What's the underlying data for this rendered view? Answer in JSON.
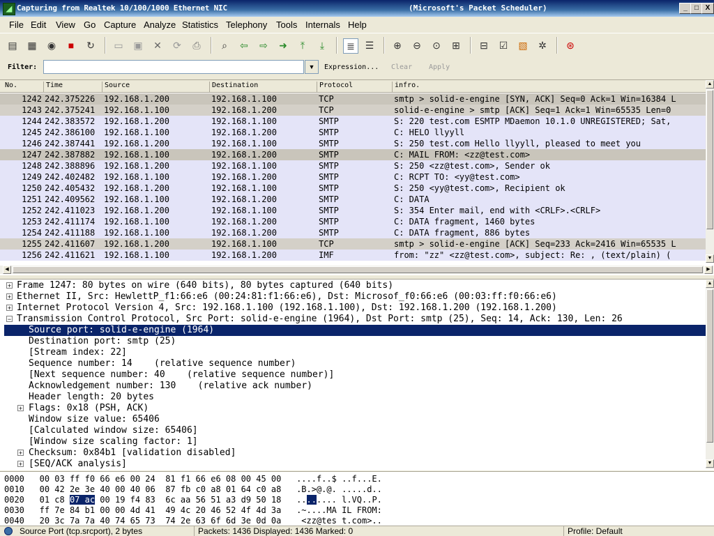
{
  "window": {
    "title": "Capturing from Realtek 10/100/1000 Ethernet NIC",
    "title_suffix": "(Microsoft's Packet Scheduler)",
    "minimize": "_",
    "maximize": "□",
    "close": "X"
  },
  "menu": [
    "File",
    "Edit",
    "View",
    "Go",
    "Capture",
    "Analyze",
    "Statistics",
    "Telephony",
    "Tools",
    "Internals",
    "Help"
  ],
  "filter": {
    "label": "Filter:",
    "value": "",
    "expression": "Expression...",
    "clear": "Clear",
    "apply": "Apply"
  },
  "packet_list": {
    "columns": [
      "No.",
      "Time",
      "Source",
      "Destination",
      "Protocol",
      "infro."
    ],
    "rows": [
      {
        "no": "1242",
        "time": "242.375226",
        "src": "192.168.1.200",
        "dst": "192.168.1.100",
        "proto": "TCP",
        "info": "smtp > solid-e-engine [SYN, ACK] Seq=0 Ack=1 Win=16384 L"
      },
      {
        "no": "1243",
        "time": "242.375241",
        "src": "192.168.1.100",
        "dst": "192.168.1.200",
        "proto": "TCP",
        "info": "solid-e-engine > smtp [ACK] Seq=1 Ack=1 Win=65535 Len=0"
      },
      {
        "no": "1244",
        "time": "242.383572",
        "src": "192.168.1.200",
        "dst": "192.168.1.100",
        "proto": "SMTP",
        "info": "S: 220 test.com ESMTP MDaemon 10.1.0 UNREGISTERED; Sat,"
      },
      {
        "no": "1245",
        "time": "242.386100",
        "src": "192.168.1.100",
        "dst": "192.168.1.200",
        "proto": "SMTP",
        "info": "C: HELO llyyll"
      },
      {
        "no": "1246",
        "time": "242.387441",
        "src": "192.168.1.200",
        "dst": "192.168.1.100",
        "proto": "SMTP",
        "info": "S: 250 test.com Hello llyyll, pleased to meet you"
      },
      {
        "no": "1247",
        "time": "242.387882",
        "src": "192.168.1.100",
        "dst": "192.168.1.200",
        "proto": "SMTP",
        "info": "C: MAIL FROM: <zz@test.com>"
      },
      {
        "no": "1248",
        "time": "242.388896",
        "src": "192.168.1.200",
        "dst": "192.168.1.100",
        "proto": "SMTP",
        "info": "S: 250 <zz@test.com>, Sender ok"
      },
      {
        "no": "1249",
        "time": "242.402482",
        "src": "192.168.1.100",
        "dst": "192.168.1.200",
        "proto": "SMTP",
        "info": "C: RCPT TO: <yy@test.com>"
      },
      {
        "no": "1250",
        "time": "242.405432",
        "src": "192.168.1.200",
        "dst": "192.168.1.100",
        "proto": "SMTP",
        "info": "S: 250 <yy@test.com>, Recipient ok"
      },
      {
        "no": "1251",
        "time": "242.409562",
        "src": "192.168.1.100",
        "dst": "192.168.1.200",
        "proto": "SMTP",
        "info": "C: DATA"
      },
      {
        "no": "1252",
        "time": "242.411023",
        "src": "192.168.1.200",
        "dst": "192.168.1.100",
        "proto": "SMTP",
        "info": "S: 354 Enter mail, end with <CRLF>.<CRLF>"
      },
      {
        "no": "1253",
        "time": "242.411174",
        "src": "192.168.1.100",
        "dst": "192.168.1.200",
        "proto": "SMTP",
        "info": "C: DATA fragment, 1460 bytes"
      },
      {
        "no": "1254",
        "time": "242.411188",
        "src": "192.168.1.100",
        "dst": "192.168.1.200",
        "proto": "SMTP",
        "info": "C: DATA fragment, 886 bytes"
      },
      {
        "no": "1255",
        "time": "242.411607",
        "src": "192.168.1.200",
        "dst": "192.168.1.100",
        "proto": "TCP",
        "info": "smtp > solid-e-engine [ACK] Seq=233 Ack=2416 Win=65535 L"
      },
      {
        "no": "1256",
        "time": "242.411621",
        "src": "192.168.1.100",
        "dst": "192.168.1.200",
        "proto": "IMF",
        "info": "from: \"zz\" <zz@test.com>, subject: Re: ,  (text/plain) ("
      }
    ],
    "tcp_color": "#d4d0c8",
    "smtp_color": "#e4e4f8",
    "selected_color": "#c9c5bb"
  },
  "details": [
    {
      "expander": "+",
      "text": "Frame 1247: 80 bytes on wire (640 bits), 80 bytes captured (640 bits)"
    },
    {
      "expander": "+",
      "text": "Ethernet II, Src: HewlettP_f1:66:e6 (00:24:81:f1:66:e6), Dst: Microsof_f0:66:e6 (00:03:ff:f0:66:e6)"
    },
    {
      "expander": "+",
      "text": "Internet Protocol Version 4, Src: 192.168.1.100 (192.168.1.100), Dst: 192.168.1.200 (192.168.1.200)"
    },
    {
      "expander": "−",
      "text": "Transmission Control Protocol, Src Port: solid-e-engine (1964), Dst Port: smtp (25), Seq: 14, Ack: 130, Len: 26"
    },
    {
      "expander": "",
      "text": "Source port: solid-e-engine (1964)",
      "selected": true
    },
    {
      "expander": "",
      "text": "Destination port: smtp (25)"
    },
    {
      "expander": "",
      "text": "[Stream index: 22]"
    },
    {
      "expander": "",
      "text": "Sequence number: 14    (relative sequence number)"
    },
    {
      "expander": "",
      "text": "[Next sequence number: 40    (relative sequence number)]"
    },
    {
      "expander": "",
      "text": "Acknowledgement number: 130    (relative ack number)"
    },
    {
      "expander": "",
      "text": "Header length: 20 bytes"
    },
    {
      "expander": "+",
      "text": "Flags: 0x18 (PSH, ACK)"
    },
    {
      "expander": "",
      "text": "Window size value: 65406"
    },
    {
      "expander": "",
      "text": "[Calculated window size: 65406]"
    },
    {
      "expander": "",
      "text": "[Window size scaling factor: 1]"
    },
    {
      "expander": "+",
      "text": "Checksum: 0x84b1 [validation disabled]"
    },
    {
      "expander": "+",
      "text": "[SEQ/ACK analysis]"
    }
  ],
  "hex": [
    {
      "offset": "0000",
      "bytes": "00 03 ff f0 66 e6 00 24  81 f1 66 e6 08 00 45 00",
      "ascii": "....f..$ ..f...E."
    },
    {
      "offset": "0010",
      "bytes": "00 42 2e 3e 40 00 40 06  87 fb c0 a8 01 64 c0 a8",
      "ascii": ".B.>@.@. .....d.."
    },
    {
      "offset": "0020",
      "bytes_pre": "01 c8 ",
      "bytes_hl": "07 ac",
      "bytes_post": " 00 19 f4 83  6c aa 56 51 a3 d9 50 18",
      "ascii_pre": "..",
      "ascii_hl": "..",
      "ascii_post": ".... l.VQ..P."
    },
    {
      "offset": "0030",
      "bytes": "ff 7e 84 b1 00 00 4d 41  49 4c 20 46 52 4f 4d 3a",
      "ascii": ".~....MA IL FROM:"
    },
    {
      "offset": "0040",
      "bytes": "20 3c 7a 7a 40 74 65 73  74 2e 63 6f 6d 3e 0d 0a",
      "ascii": " <zz@tes t.com>.."
    }
  ],
  "status": {
    "field": "Source Port (tcp.srcport), 2 bytes",
    "packets": "Packets: 1436 Displayed: 1436 Marked: 0",
    "profile": "Profile: Default"
  },
  "colors": {
    "selection_blue": "#0a246a",
    "title_blue": "#0a246a"
  }
}
